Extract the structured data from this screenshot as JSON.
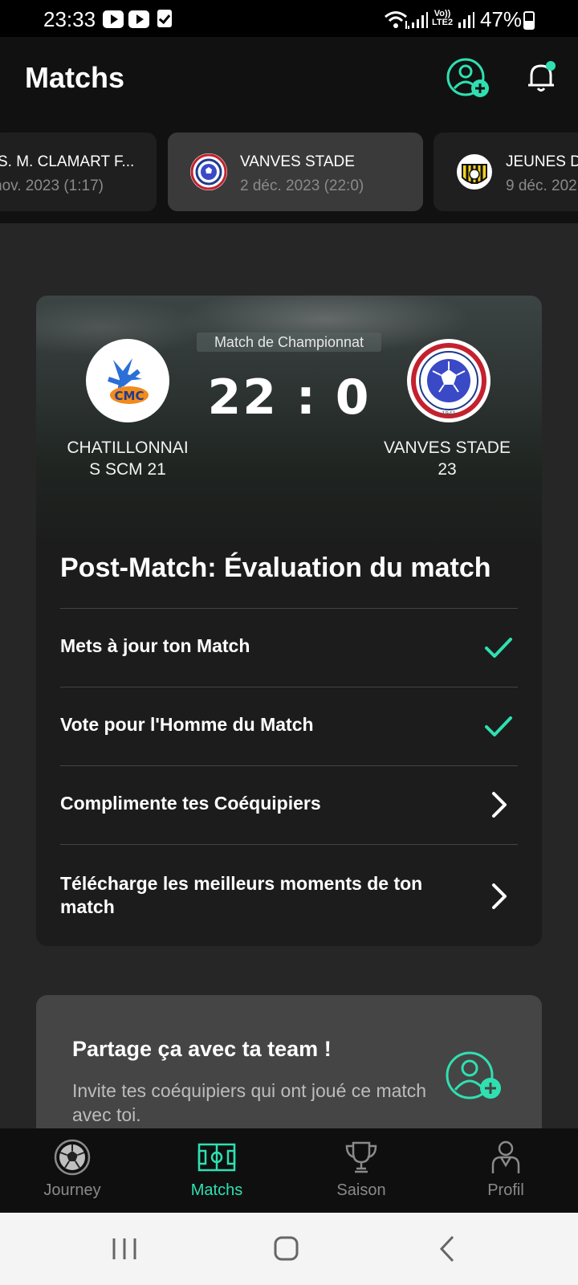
{
  "status_bar": {
    "time": "23:33",
    "battery": "47%",
    "icons": [
      "youtube-icon",
      "youtube-icon",
      "checkbox-icon",
      "wifi-icon",
      "signal-icon",
      "volte-icon",
      "signal-icon",
      "battery-icon"
    ],
    "volte_label": "Vo)) LTE2"
  },
  "header": {
    "title": "Matchs",
    "add_user_icon": "add-user-icon",
    "notification_icon": "bell-icon"
  },
  "matches": [
    {
      "team": "S. M. CLAMART F...",
      "date": "nov. 2023 (1:17)",
      "active": false
    },
    {
      "team": "VANVES STADE",
      "date": "2 déc. 2023 (22:0)",
      "active": true
    },
    {
      "team": "JEUNES D",
      "date": "9 déc. 202",
      "active": false
    }
  ],
  "match_card": {
    "match_type": "Match de Championnat",
    "score": "22 : 0",
    "home_team": "CHATILLONNAIS SCM 21",
    "home_team_lines": [
      "CHATILLONNAI",
      "S SCM 21"
    ],
    "home_logo_text": "CMC",
    "away_team_lines": [
      "VANVES STADE",
      "23"
    ],
    "away_logo_text": "STADE DE VANVES",
    "away_logo_year": "1941",
    "postmatch_title": "Post-Match: Évaluation du match",
    "tasks": [
      {
        "label": "Mets à jour ton Match",
        "status": "done",
        "icon": "check-icon"
      },
      {
        "label": "Vote pour l'Homme du Match",
        "status": "done",
        "icon": "check-icon"
      },
      {
        "label": "Complimente tes Coéquipiers",
        "status": "todo",
        "icon": "chevron-right-icon"
      },
      {
        "label": "Télécharge les meilleurs moments de ton match",
        "status": "todo",
        "icon": "chevron-right-icon"
      }
    ]
  },
  "share_card": {
    "title": "Partage ça avec ta team !",
    "text": "Invite tes coéquipiers qui ont joué ce match avec toi.",
    "icon": "add-user-icon"
  },
  "bottom_nav": [
    {
      "label": "Journey",
      "icon": "soccer-ball-icon",
      "active": false
    },
    {
      "label": "Matchs",
      "icon": "pitch-icon",
      "active": true
    },
    {
      "label": "Saison",
      "icon": "trophy-icon",
      "active": false
    },
    {
      "label": "Profil",
      "icon": "player-icon",
      "active": false
    }
  ],
  "colors": {
    "accent": "#2fe0b1",
    "background": "#262626",
    "header": "#111111",
    "card": "#1c1c1c"
  }
}
